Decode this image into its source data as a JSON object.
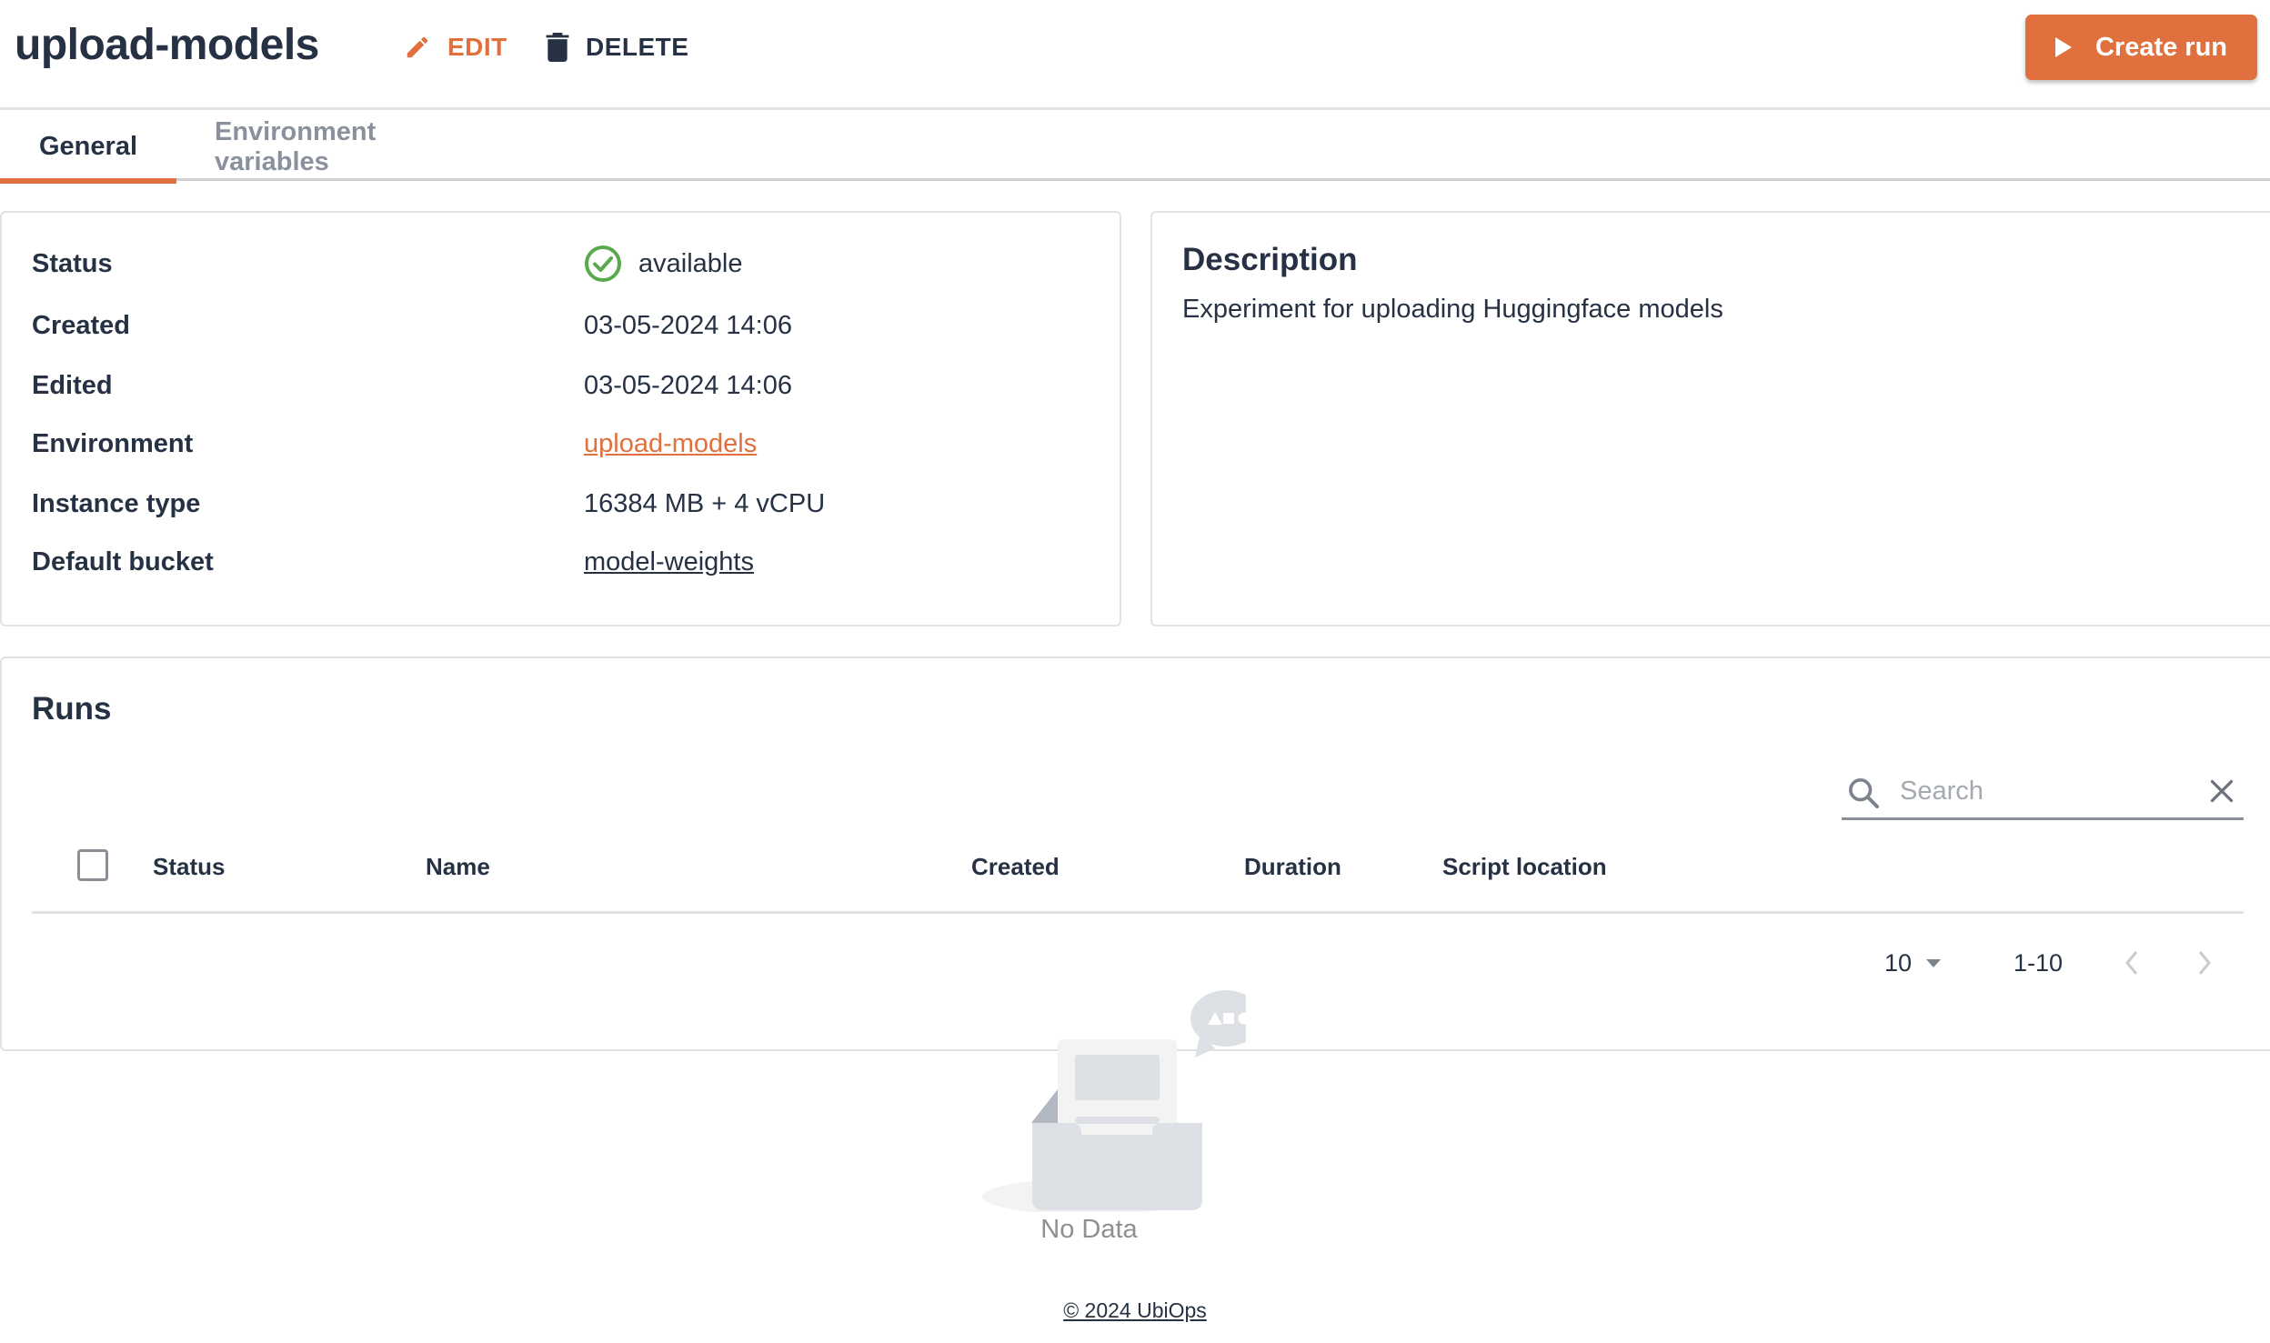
{
  "header": {
    "title": "upload-models",
    "edit_label": "EDIT",
    "delete_label": "DELETE",
    "create_run_label": "Create run"
  },
  "tabs": [
    {
      "label": "General",
      "active": true
    },
    {
      "label": "Environment variables",
      "active": false
    }
  ],
  "info": {
    "status": {
      "label": "Status",
      "value": "available",
      "icon": "check-circle-icon",
      "color": "#5aa94f"
    },
    "created": {
      "label": "Created",
      "value": "03-05-2024 14:06"
    },
    "edited": {
      "label": "Edited",
      "value": "03-05-2024 14:06"
    },
    "environment": {
      "label": "Environment",
      "value": "upload-models"
    },
    "instance_type": {
      "label": "Instance type",
      "value": "16384 MB + 4 vCPU"
    },
    "default_bucket": {
      "label": "Default bucket",
      "value": "model-weights"
    }
  },
  "description": {
    "title": "Description",
    "text": "Experiment for uploading Huggingface models"
  },
  "runs": {
    "title": "Runs",
    "search": {
      "placeholder": "Search",
      "value": ""
    },
    "columns": [
      "Status",
      "Name",
      "Created",
      "Duration",
      "Script location"
    ],
    "rows": [],
    "pagination": {
      "page_size": "10",
      "range": "1-10"
    },
    "empty_text": "No Data"
  },
  "footer": {
    "text": "© 2024 UbiOps"
  },
  "colors": {
    "accent": "#e0703d",
    "text": "#263244",
    "success": "#5aa94f"
  }
}
